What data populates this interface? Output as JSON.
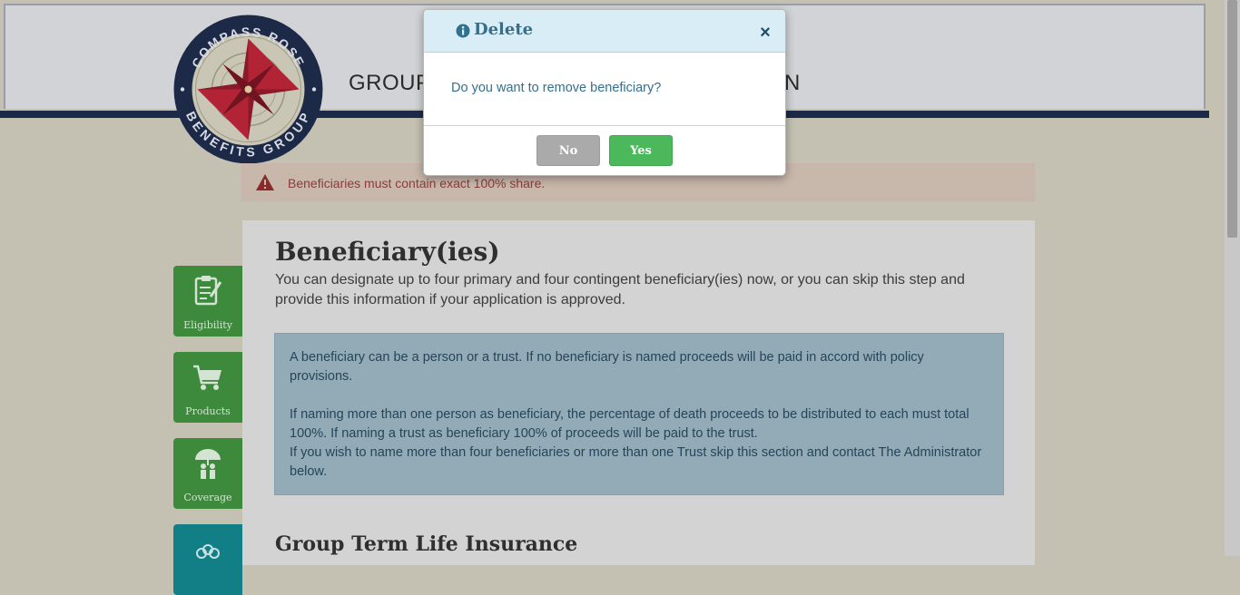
{
  "header": {
    "title_visible": "GROUP",
    "title_tail_visible": "N",
    "logo_top_text": "COMPASS ROSE",
    "logo_bottom_text": "BENEFITS GROUP"
  },
  "alert": {
    "icon": "warning-icon",
    "text": "Beneficiaries must contain exact 100% share."
  },
  "sidebar": {
    "items": [
      {
        "label": "Eligibility",
        "icon": "checklist-pencil-icon"
      },
      {
        "label": "Products",
        "icon": "shopping-cart-icon"
      },
      {
        "label": "Coverage",
        "icon": "umbrella-family-icon"
      },
      {
        "label": "",
        "icon": "people-group-icon"
      }
    ]
  },
  "main": {
    "title": "Beneficiary(ies)",
    "intro": "You can designate up to four primary and four contingent beneficiary(ies) now, or you can skip this step and provide this information if your application is approved.",
    "info_paragraphs": [
      "A beneficiary can be a person or a trust. If no beneficiary is named proceeds will be paid in accord with policy provisions.",
      "If naming more than one person as beneficiary, the percentage of death proceeds to be distributed to each must total 100%. If naming a trust as beneficiary 100% of proceeds will be paid to the trust.",
      "If you wish to name more than four beneficiaries or more than one Trust skip this section and contact The Administrator below."
    ],
    "section_title": "Group Term Life Insurance"
  },
  "modal": {
    "title": "Delete",
    "icon": "info-circle-icon",
    "close_label": "×",
    "message": "Do you want to remove beneficiary?",
    "no_label": "No",
    "yes_label": "Yes"
  },
  "colors": {
    "modal_header_bg": "#d9edf7",
    "modal_text": "#31708f",
    "yes_button": "#5cb85c",
    "no_button": "#aaaaaa",
    "sidebar_green": "#3d8a3d",
    "sidebar_teal": "#127f86"
  }
}
